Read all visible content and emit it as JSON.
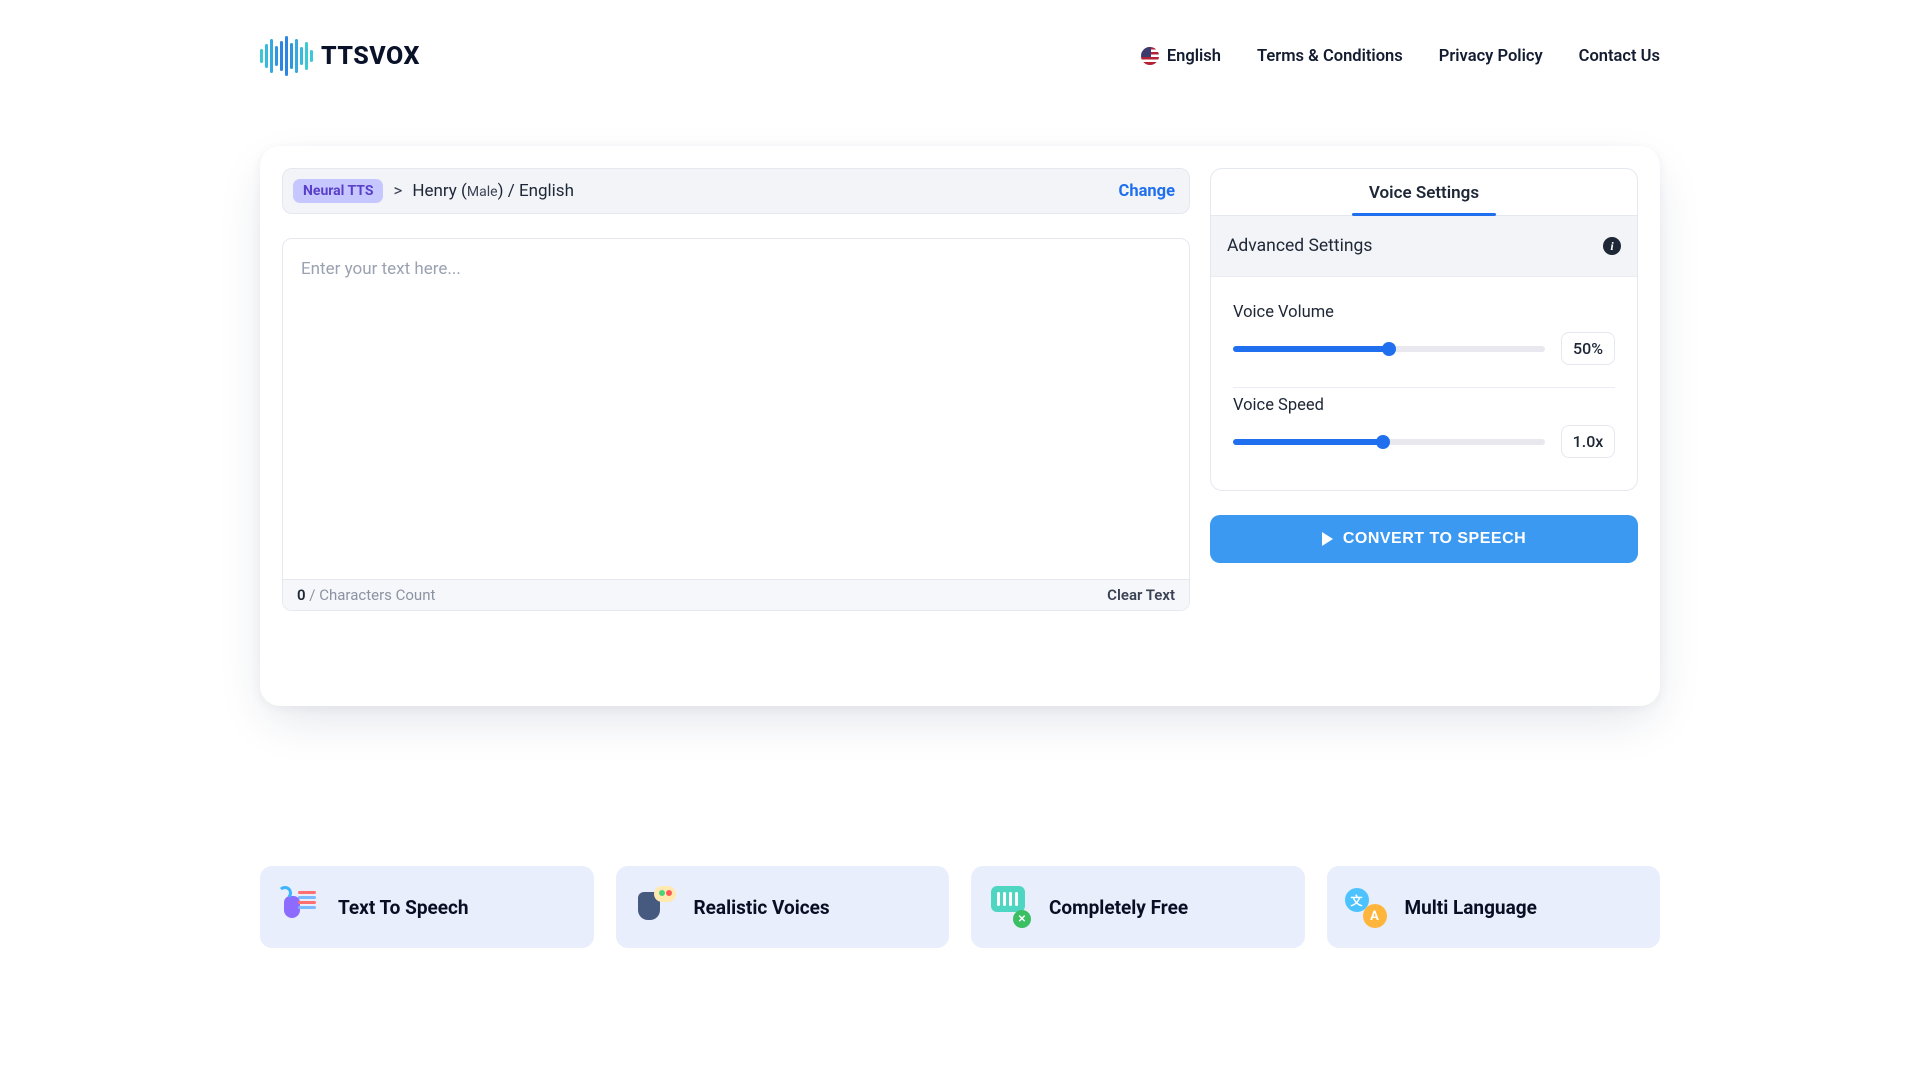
{
  "brand": {
    "name": "TTSVOX"
  },
  "nav": {
    "language": "English",
    "terms": "Terms & Conditions",
    "privacy": "Privacy Policy",
    "contact": "Contact Us"
  },
  "voice_bar": {
    "badge": "Neural TTS",
    "separator": ">",
    "voice_name": "Henry",
    "voice_gender": "Male",
    "voice_lang": "English",
    "change": "Change"
  },
  "editor": {
    "placeholder": "Enter your text here...",
    "char_count": "0",
    "char_count_sep": " / ",
    "char_count_label": "Characters Count",
    "clear": "Clear Text"
  },
  "settings": {
    "tab": "Voice Settings",
    "advanced_title": "Advanced Settings",
    "volume": {
      "label": "Voice Volume",
      "value_text": "50%",
      "percent": 50
    },
    "speed": {
      "label": "Voice Speed",
      "value_text": "1.0x",
      "percent": 48
    }
  },
  "convert_button": "CONVERT TO SPEECH",
  "features": {
    "f1": "Text To Speech",
    "f2": "Realistic Voices",
    "f3": "Completely Free",
    "f4": "Multi Language"
  },
  "colors": {
    "accent": "#1f6fee",
    "button": "#3c99f2",
    "badge_bg": "#c7c7ff",
    "badge_fg": "#5a40c9",
    "panel_bg": "#f2f4f8",
    "feature_bg": "#e8eefb"
  }
}
